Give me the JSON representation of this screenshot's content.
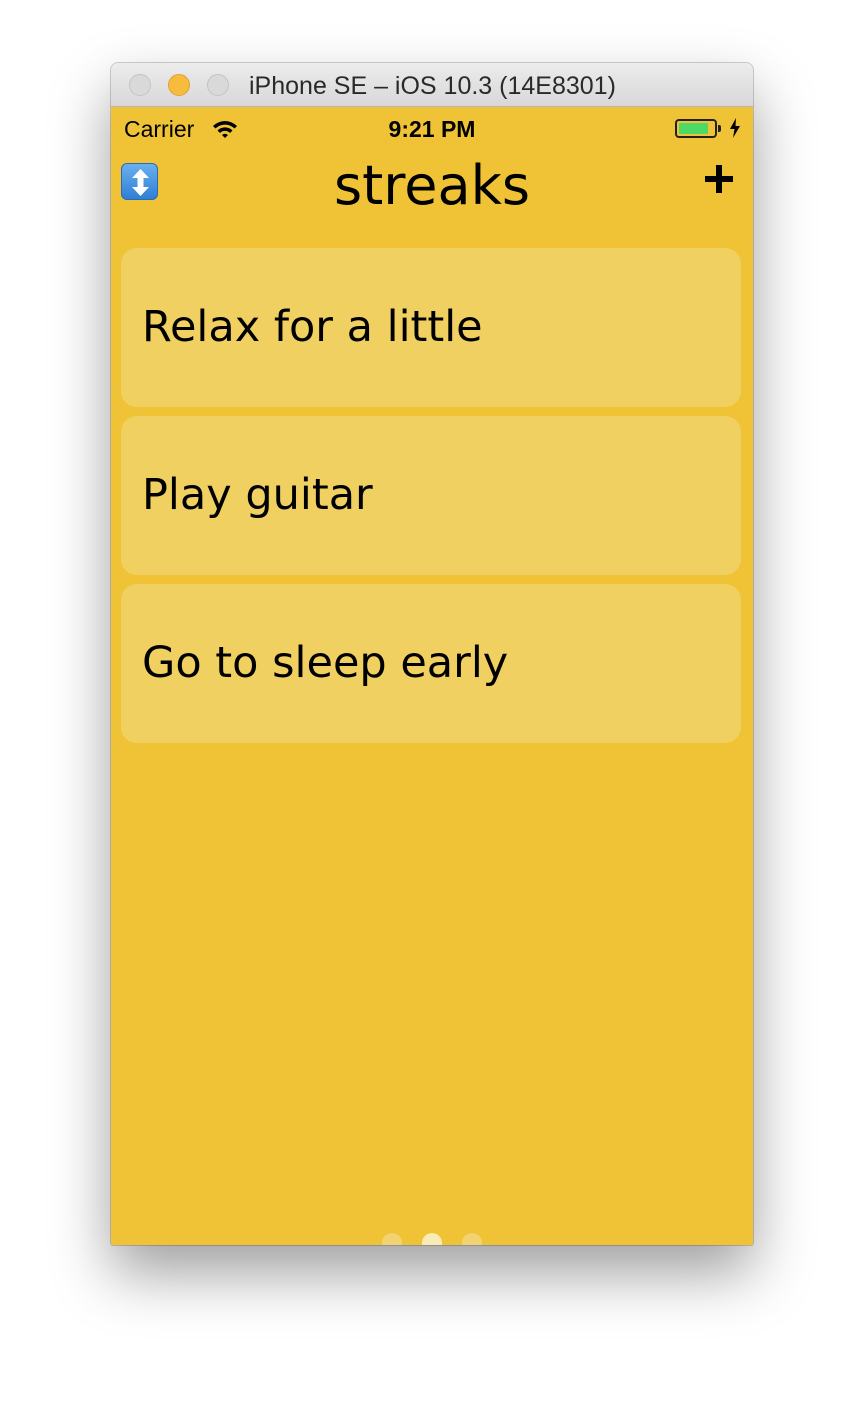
{
  "window": {
    "title": "iPhone SE – iOS 10.3 (14E8301)"
  },
  "status_bar": {
    "carrier": "Carrier",
    "time": "9:21 PM",
    "battery_level": 0.85
  },
  "nav": {
    "title": "streaks",
    "sort_icon": "up-down-arrow-icon",
    "add_icon": "plus-icon"
  },
  "streaks": [
    {
      "label": "Relax for a little"
    },
    {
      "label": "Play guitar"
    },
    {
      "label": "Go to sleep early"
    }
  ],
  "pager": {
    "count": 3,
    "active_index": 1
  },
  "colors": {
    "background": "#f0c337",
    "card": "#f1d062",
    "battery": "#4cd964"
  }
}
